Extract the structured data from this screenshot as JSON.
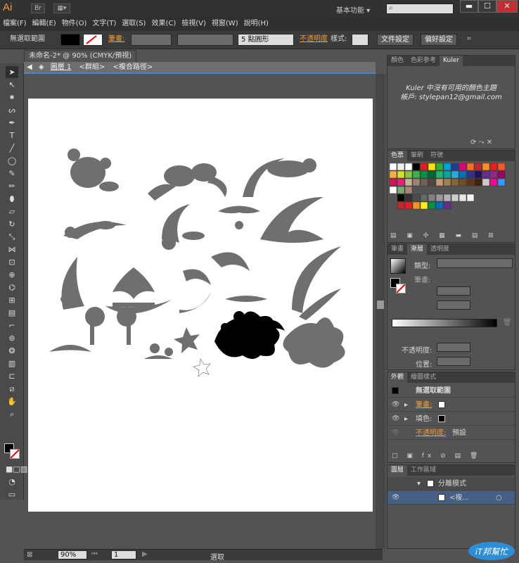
{
  "app": {
    "logo": "Ai",
    "workspace": "基本功能",
    "minimize": "▬",
    "restore": "☐",
    "close": "✕"
  },
  "menus": [
    "檔案(F)",
    "編輯(E)",
    "物件(O)",
    "文字(T)",
    "選取(S)",
    "效果(C)",
    "檢視(V)",
    "視窗(W)",
    "說明(H)"
  ],
  "control": {
    "selection": "無選取範圍",
    "stroke_label": "筆畫:",
    "brush": "5 點圓形",
    "opacity_label": "不透明度",
    "style_label": "樣式:",
    "doc_setup": "文件設定",
    "prefs": "偏好設定"
  },
  "document": {
    "tab": "未命名-2* @ 90% (CMYK/預視)",
    "tab_close": "×",
    "crumb_layer": "圖層 1",
    "crumb_group": "<群組>",
    "crumb_path": "<複合路徑>"
  },
  "status": {
    "zoom": "90%",
    "page": "1",
    "mode": "選取"
  },
  "panels": {
    "kuler": {
      "tabs": [
        "顏色",
        "色彩參考",
        "Kuler"
      ],
      "message": "Kuler 中沒有可用的顏色主題",
      "account": "帳戶: stylepan12@gmail.com"
    },
    "swatches": {
      "tabs": [
        "色票",
        "筆刷",
        "符號"
      ]
    },
    "gradient": {
      "tabs": [
        "筆畫",
        "漸層",
        "透明度"
      ],
      "type_label": "類型:",
      "stroke_label": "筆畫:",
      "opacity_label": "不透明度:",
      "position_label": "位置:"
    },
    "appearance": {
      "tabs": [
        "外觀",
        "繪圖樣式"
      ],
      "title": "無選取範圍",
      "stroke": "筆畫:",
      "fill": "填色:",
      "opacity": "不透明度:",
      "opacity_value": "預設"
    },
    "layers": {
      "tabs": [
        "圖層",
        "工作區域"
      ],
      "layer_name": "分離模式",
      "sublayer": "<複..."
    }
  },
  "watermark": {
    "text": "iT邦幫忙"
  },
  "colors": {
    "accent": "#f29a35",
    "selection_blue": "#4a82d6"
  }
}
